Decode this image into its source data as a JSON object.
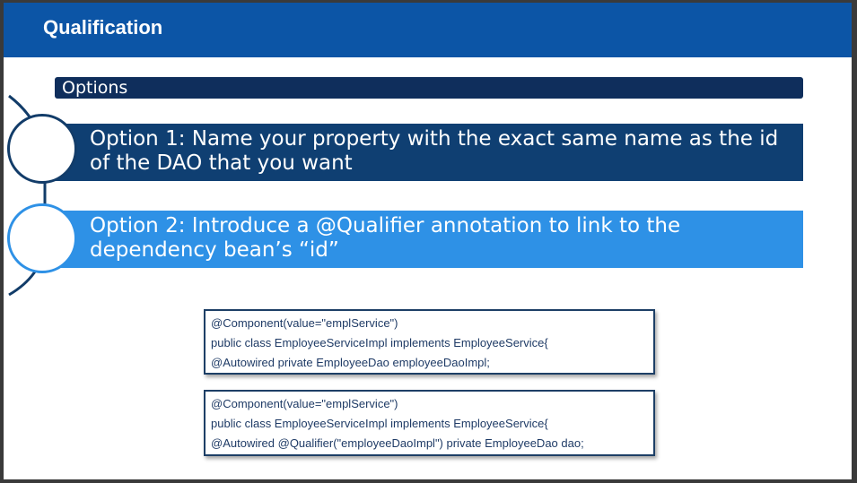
{
  "header": {
    "title": "Qualification"
  },
  "options_heading": "Options",
  "options": [
    {
      "label": "Option 1: Name your property with the exact same name as the id of the DAO that you want"
    },
    {
      "label": "Option 2: Introduce a @Qualifier annotation to link to the dependency bean’s “id”"
    }
  ],
  "code_blocks": [
    {
      "lines": [
        "@Component(value=\"emplService\")",
        "public class EmployeeServiceImpl implements EmployeeService{",
        "@Autowired private EmployeeDao employeeDaoImpl;"
      ]
    },
    {
      "lines": [
        "@Component(value=\"emplService\")",
        "public class EmployeeServiceImpl implements EmployeeService{",
        "@Autowired @Qualifier(\"employeeDaoImpl\") private EmployeeDao dao;"
      ]
    }
  ],
  "colors": {
    "header_bg": "#0c55a6",
    "options_bar": "#0f2e5c",
    "option1_bg": "#0f3f72",
    "option2_bg": "#2e91e6",
    "code_text": "#1f3b66"
  }
}
